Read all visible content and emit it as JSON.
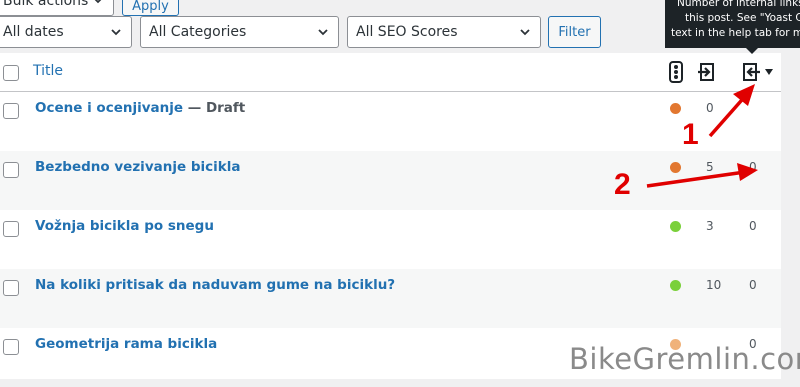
{
  "toolbar": {
    "bulk_actions": "Bulk actions",
    "apply": "Apply",
    "dates": "All dates",
    "categories": "All Categories",
    "seo_scores": "All SEO Scores",
    "filter": "Filter"
  },
  "tooltip": {
    "lines": [
      "Number of internal links li",
      "this post. See \"Yoast Co",
      "text in the help tab for mo"
    ]
  },
  "table": {
    "title_header": "Title",
    "rows": [
      {
        "title": "Ocene i ocenjivanje",
        "state": " — Draft",
        "seo_color": "#e27730",
        "links_out": "0",
        "links_in": ""
      },
      {
        "title": "Bezbedno vezivanje bicikla",
        "state": "",
        "seo_color": "#e27730",
        "links_out": "5",
        "links_in": "0"
      },
      {
        "title": "Vožnja bicikla po snegu",
        "state": "",
        "seo_color": "#7ad03a",
        "links_out": "3",
        "links_in": "0"
      },
      {
        "title": "Na koliki pritisak da naduvam gume na biciklu?",
        "state": "",
        "seo_color": "#7ad03a",
        "links_out": "10",
        "links_in": "0"
      },
      {
        "title": "Geometrija rama bicikla",
        "state": "",
        "seo_color": "#f0b27a",
        "links_out": "",
        "links_in": "0"
      }
    ]
  },
  "annotations": {
    "one": "1",
    "two": "2"
  },
  "watermark": {
    "text": "BikeGremlin.com"
  }
}
